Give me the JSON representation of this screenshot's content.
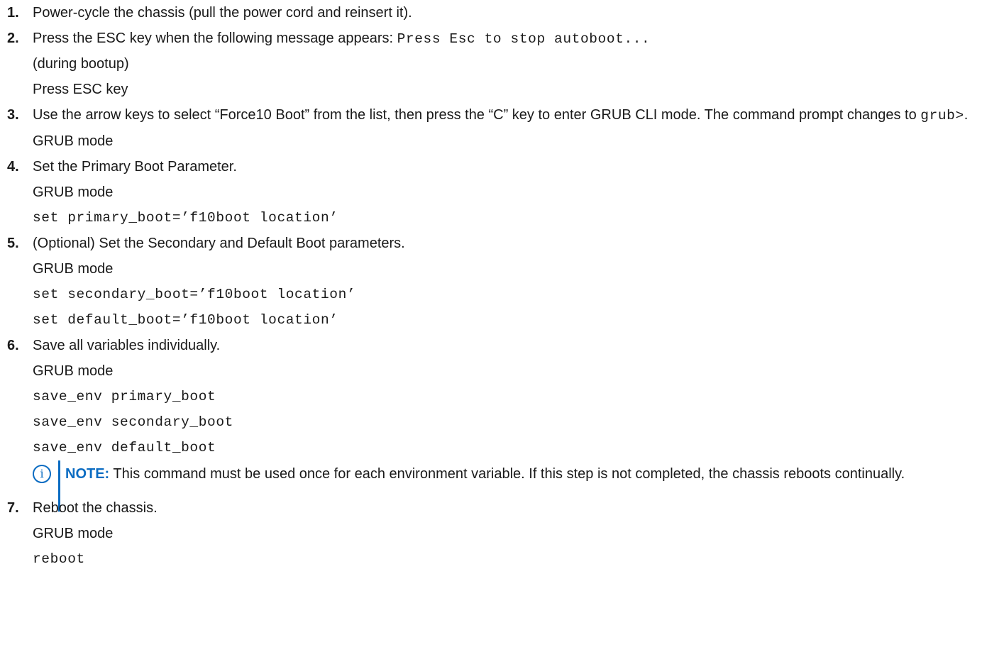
{
  "steps": [
    {
      "number": "1.",
      "text": "Power-cycle the chassis (pull the power cord and reinsert it)."
    },
    {
      "number": "2.",
      "text": "Press the ESC key when the following message appears: ",
      "code_inline": "Press Esc to stop autoboot...",
      "lines": [
        "(during bootup)",
        "Press ESC key"
      ]
    },
    {
      "number": "3.",
      "text": "Use the arrow keys to select “Force10 Boot” from the list, then press the “C” key to enter GRUB CLI mode. The command prompt changes to ",
      "code_inline": "grub>",
      "text_after": ".",
      "mode": "GRUB mode"
    },
    {
      "number": "4.",
      "text": "Set the Primary Boot Parameter.",
      "mode": "GRUB mode",
      "code": [
        "set primary_boot=’f10boot location’"
      ]
    },
    {
      "number": "5.",
      "text": "(Optional) Set the Secondary and Default Boot parameters.",
      "mode": "GRUB mode",
      "code": [
        "set secondary_boot=’f10boot location’",
        "set default_boot=’f10boot location’"
      ]
    },
    {
      "number": "6.",
      "text": "Save all variables individually.",
      "mode": "GRUB mode",
      "code": [
        "save_env primary_boot",
        "save_env secondary_boot",
        "save_env default_boot"
      ],
      "note": {
        "label": "NOTE:",
        "text": " This command must be used once for each environment variable. If this step is not completed, the chassis reboots continually.",
        "icon": "info-icon"
      }
    },
    {
      "number": "7.",
      "text": "Reboot the chassis.",
      "mode": "GRUB mode",
      "code": [
        "reboot"
      ]
    }
  ],
  "colors": {
    "note_accent": "#0b6cc2",
    "text": "#1a1a1a"
  }
}
